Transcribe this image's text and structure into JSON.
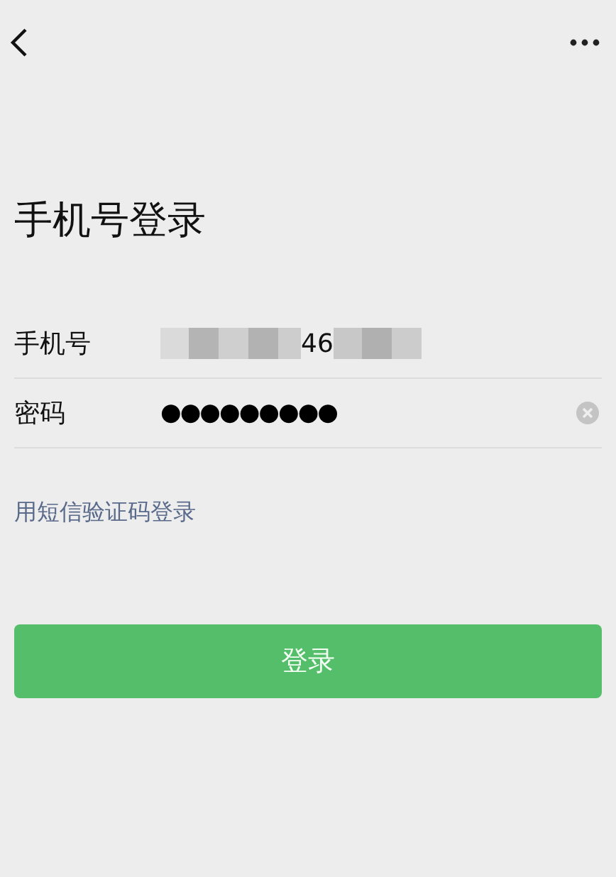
{
  "title": "手机号登录",
  "fields": [
    {
      "label": "手机号",
      "kind": "phone",
      "value": "46"
    },
    {
      "label": "密码",
      "kind": "password",
      "value": "●●●●●●●●●"
    }
  ],
  "sms_link": "用短信验证码登录",
  "login_button": "登录"
}
